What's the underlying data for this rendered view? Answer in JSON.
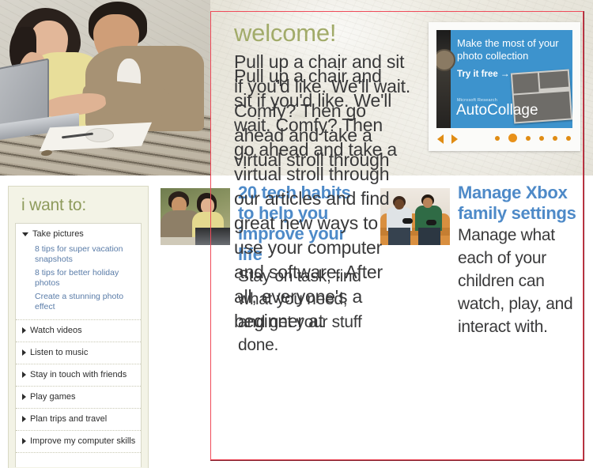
{
  "hero": {
    "photo_alt": "couple-at-laptop-photo",
    "welcome_title": "welcome!",
    "welcome_body": "Pull up a chair and sit if you'd like. We'll wait. Comfy? Then go ahead and take a virtual stroll through our articles and find great new ways to use your computer and software. After all, everyone's a beginner at",
    "ad": {
      "headline": "Make the most of your photo collection",
      "cta": "Try it free",
      "cta_arrow": "→",
      "brand_small": "Microsoft Research",
      "brand_large": "AutoCollage",
      "prev_label": "◀",
      "next_label": "▶",
      "dot_count": 6,
      "active_dot": 2,
      "accent_color": "#e08c14",
      "panel_color": "#3d93cd"
    }
  },
  "sidebar": {
    "title": "i want to:",
    "groups": [
      {
        "label": "Take pictures",
        "expanded": true,
        "links": [
          "8 tips for super vacation snapshots",
          "8 tips for better holiday photos",
          "Create a stunning photo effect"
        ]
      },
      {
        "label": "Watch videos",
        "expanded": false,
        "links": []
      },
      {
        "label": "Listen to music",
        "expanded": false,
        "links": []
      },
      {
        "label": "Stay in touch with friends",
        "expanded": false,
        "links": []
      },
      {
        "label": "Play games",
        "expanded": false,
        "links": []
      },
      {
        "label": "Plan trips and travel",
        "expanded": false,
        "links": []
      },
      {
        "label": "Improve my computer skills",
        "expanded": false,
        "links": []
      }
    ]
  },
  "articles": [
    {
      "thumb_alt": "couple-with-laptop-thumbnail",
      "title": "20 tech habits to help you improve your life",
      "text": "Stay on task, find what you need, and get your stuff done.",
      "title_color": "#4e8ac8"
    },
    {
      "thumb_alt": "two-men-playing-xbox-thumbnail",
      "title": "Manage Xbox family settings",
      "text": "Manage what each of your children can watch, play, and interact with.",
      "title_color": "#4e8ac8"
    }
  ],
  "annotation": {
    "highlight_color": "#ef4b5a",
    "shadow_color": "#7e1b28"
  }
}
